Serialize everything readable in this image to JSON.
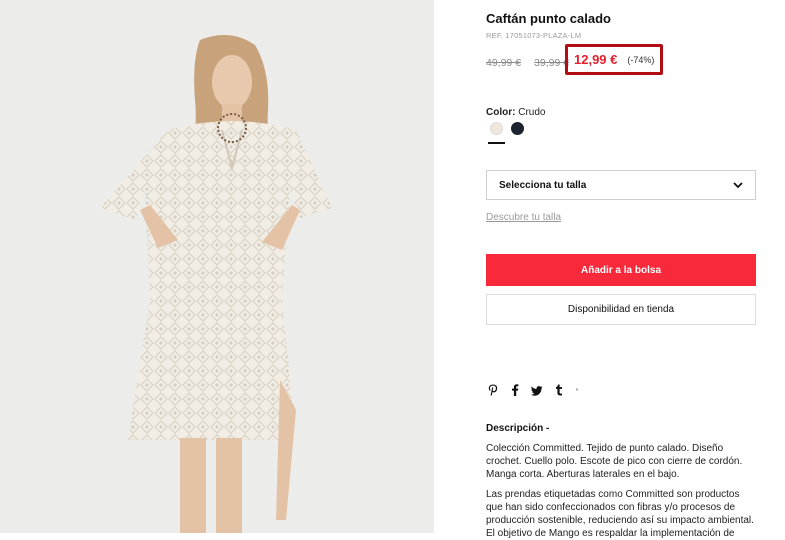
{
  "product": {
    "title": "Caftán punto calado",
    "ref": "REF. 17051073-PLAZA-LM",
    "old_price_1": "49,99 €",
    "old_price_2": "39,99 €",
    "price": "12,99 €",
    "discount": "(-74%)"
  },
  "color": {
    "label": "Color:",
    "value": "Crudo",
    "swatches": [
      {
        "name": "Crudo",
        "hex": "#efe6dc"
      },
      {
        "name": "Negro",
        "hex": "#1e2330"
      }
    ]
  },
  "size": {
    "select_label": "Selecciona tu talla",
    "guide_link": "Descubre tu talla"
  },
  "actions": {
    "add_to_bag": "Añadir a la bolsa",
    "store_availability": "Disponibilidad en tienda"
  },
  "share": {
    "icons": [
      "pinterest-icon",
      "facebook-icon",
      "twitter-icon",
      "tumblr-icon"
    ],
    "glyphs": [
      "P",
      "f",
      "🐦",
      "t"
    ],
    "extra": "'"
  },
  "description": {
    "title": "Descripción -",
    "p1": "Colección Committed. Tejido de punto calado. Diseño crochet. Cuello polo. Escote de pico con cierre de cordón. Manga corta. Aberturas laterales en el bajo.",
    "p2": "Las prendas etiquetadas como Committed son productos que han sido confeccionados con fibras y/o procesos de producción sostenible, reduciendo así su impacto ambiental. El objetivo de Mango es respaldar la implementación de"
  },
  "colors": {
    "accent_red": "#f8293a",
    "price_red": "#e3202e",
    "highlight_border": "#b10e14"
  }
}
